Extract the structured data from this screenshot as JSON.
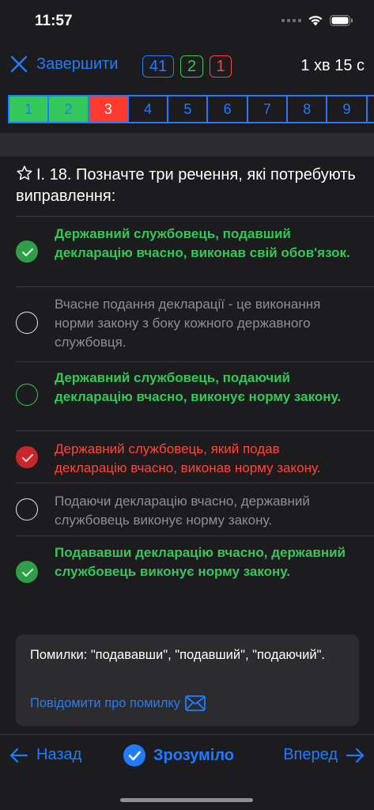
{
  "status": {
    "time": "11:57"
  },
  "nav": {
    "finish_label": "Завершити",
    "total_count": "41",
    "correct_count": "2",
    "wrong_count": "1",
    "timer": "1 хв 15 с"
  },
  "questions": [
    "1",
    "2",
    "3",
    "4",
    "5",
    "6",
    "7",
    "8",
    "9"
  ],
  "question": {
    "text": "І. 18. Позначте три речення, які потребують виправлення:"
  },
  "answers": [
    {
      "text": "Державний службовець, подавший декларацію вчасно, виконав свій обов'язок."
    },
    {
      "text": "Вчасне подання декларації - це виконання норми закону з боку кожного державного службовця."
    },
    {
      "text": "Державний службовець, подаючий декларацію вчасно, виконує норму закону."
    },
    {
      "text": "Державний службовець, який подав декларацію вчасно, виконав норму закону."
    },
    {
      "text": "Подаючи декларацію вчасно, державний службовець виконує норму закону."
    },
    {
      "text": "Подававши декларацію вчасно, державний службовець виконує норму закону."
    }
  ],
  "explanation": {
    "text": "Помилки: \"подававши\", \"подавший\", \"подаючий\".",
    "report_link": "Повідомити про помилку"
  },
  "bottom": {
    "back_label": "Назад",
    "ok_label": "Зрозуміло",
    "forward_label": "Вперед"
  },
  "colors": {
    "accent": "#1f7cff",
    "correct": "#34c759",
    "wrong": "#ff453a",
    "background": "#1c1c1e"
  }
}
